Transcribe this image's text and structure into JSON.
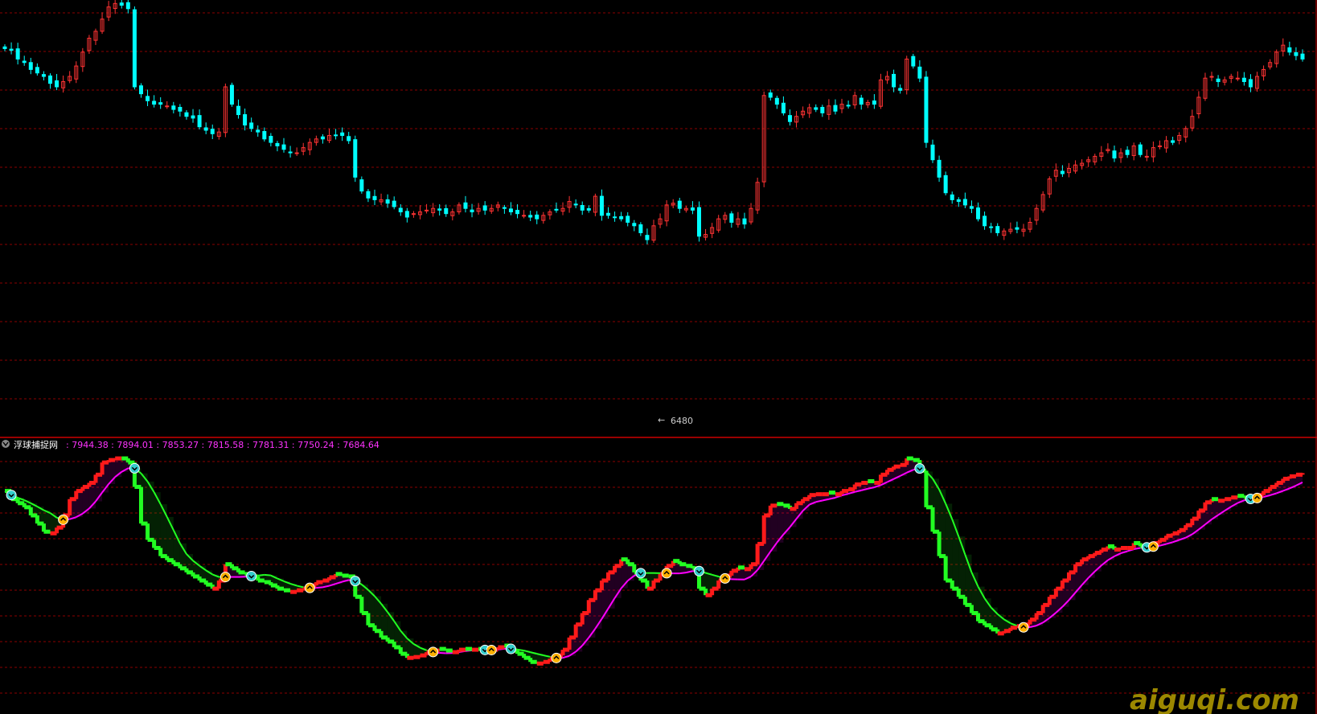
{
  "indicator": {
    "name": "浮球捕捉网",
    "values": [
      "7944.38",
      "7894.01",
      "7853.27",
      "7815.58",
      "7781.31",
      "7750.24",
      "7684.64"
    ],
    "sep": " : "
  },
  "price_pane": {
    "low_marker": "6480"
  },
  "watermark": "aiguqi.com",
  "colors": {
    "background": "#000000",
    "grid": "#8b0000",
    "candle_up": "#ff3333",
    "candle_down": "#00ffff",
    "line_green": "#22ff22",
    "line_red": "#ff1a1a",
    "line_magenta": "#ff00ff",
    "label_cyan": "#00ffff",
    "label_magenta": "#ff33ff",
    "watermark": "#b8a000"
  },
  "chart_data": [
    {
      "type": "candlestick",
      "title": "",
      "xlabel": "",
      "ylabel": "",
      "ylim": [
        6400,
        8900
      ],
      "grid": true,
      "close": [
        8620,
        8610,
        8560,
        8540,
        8500,
        8480,
        8460,
        8420,
        8400,
        8430,
        8460,
        8520,
        8600,
        8680,
        8720,
        8790,
        8860,
        8880,
        8870,
        8850,
        8400,
        8360,
        8320,
        8300,
        8300,
        8290,
        8270,
        8260,
        8230,
        8220,
        8170,
        8150,
        8130,
        8140,
        8400,
        8300,
        8240,
        8180,
        8160,
        8140,
        8100,
        8080,
        8060,
        8040,
        8020,
        8020,
        8050,
        8080,
        8100,
        8100,
        8120,
        8120,
        8120,
        8090,
        7880,
        7800,
        7760,
        7750,
        7750,
        7730,
        7710,
        7680,
        7650,
        7670,
        7680,
        7690,
        7700,
        7690,
        7670,
        7680,
        7720,
        7700,
        7680,
        7700,
        7690,
        7700,
        7720,
        7700,
        7680,
        7670,
        7660,
        7650,
        7640,
        7660,
        7680,
        7690,
        7700,
        7740,
        7720,
        7690,
        7690,
        7770,
        7660,
        7660,
        7650,
        7640,
        7620,
        7600,
        7560,
        7520,
        7600,
        7640,
        7720,
        7730,
        7700,
        7700,
        7690,
        7540,
        7550,
        7590,
        7640,
        7660,
        7620,
        7640,
        7610,
        7700,
        7850,
        8350,
        8340,
        8300,
        8250,
        8200,
        8230,
        8260,
        8280,
        8270,
        8250,
        8290,
        8260,
        8300,
        8290,
        8350,
        8300,
        8310,
        8300,
        8440,
        8460,
        8400,
        8380,
        8560,
        8520,
        8450,
        8080,
        7980,
        7880,
        7790,
        7750,
        7740,
        7720,
        7700,
        7640,
        7600,
        7590,
        7560,
        7570,
        7580,
        7580,
        7580,
        7620,
        7700,
        7780,
        7870,
        7920,
        7900,
        7930,
        7950,
        7960,
        7980,
        8000,
        8020,
        8040,
        7990,
        8020,
        8010,
        8060,
        8010,
        8000,
        8050,
        8060,
        8090,
        8080,
        8120,
        8160,
        8230,
        8340,
        8450,
        8460,
        8430,
        8440,
        8460,
        8450,
        8430,
        8400,
        8460,
        8500,
        8540,
        8600,
        8640,
        8600,
        8580,
        8560
      ]
    },
    {
      "type": "line",
      "title": "浮球捕捉网",
      "xlabel": "",
      "ylabel": "",
      "ylim": [
        7640,
        7960
      ],
      "grid": true,
      "series": [
        {
          "name": "",
          "values": [
            7910,
            7900,
            7895,
            7890,
            7880,
            7870,
            7860,
            7858,
            7865,
            7880,
            7900,
            7910,
            7915,
            7920,
            7930,
            7945,
            7948,
            7950,
            7950,
            7945,
            7915,
            7870,
            7850,
            7840,
            7830,
            7825,
            7820,
            7815,
            7810,
            7805,
            7800,
            7795,
            7790,
            7800,
            7820,
            7815,
            7810,
            7808,
            7805,
            7800,
            7798,
            7794,
            7790,
            7788,
            7786,
            7788,
            7790,
            7794,
            7798,
            7800,
            7804,
            7808,
            7806,
            7805,
            7780,
            7760,
            7745,
            7738,
            7730,
            7725,
            7718,
            7710,
            7705,
            7706,
            7708,
            7712,
            7714,
            7716,
            7714,
            7712,
            7715,
            7716,
            7715,
            7716,
            7714,
            7715,
            7718,
            7720,
            7714,
            7710,
            7705,
            7700,
            7698,
            7700,
            7704,
            7708,
            7715,
            7730,
            7746,
            7760,
            7776,
            7788,
            7800,
            7810,
            7818,
            7826,
            7820,
            7810,
            7800,
            7790,
            7800,
            7808,
            7818,
            7824,
            7820,
            7818,
            7815,
            7790,
            7782,
            7790,
            7800,
            7806,
            7812,
            7816,
            7814,
            7820,
            7845,
            7880,
            7892,
            7894,
            7892,
            7888,
            7895,
            7900,
            7905,
            7906,
            7906,
            7908,
            7906,
            7910,
            7912,
            7918,
            7920,
            7922,
            7920,
            7930,
            7936,
            7940,
            7942,
            7950,
            7948,
            7935,
            7890,
            7860,
            7830,
            7800,
            7790,
            7780,
            7770,
            7760,
            7750,
            7745,
            7740,
            7735,
            7738,
            7742,
            7744,
            7746,
            7752,
            7760,
            7770,
            7780,
            7790,
            7800,
            7810,
            7820,
            7826,
            7830,
            7834,
            7838,
            7842,
            7838,
            7840,
            7840,
            7846,
            7842,
            7840,
            7846,
            7850,
            7855,
            7858,
            7862,
            7868,
            7876,
            7886,
            7896,
            7900,
            7898,
            7900,
            7902,
            7904,
            7902,
            7900,
            7905,
            7910,
            7915,
            7920,
            7925,
            7928,
            7930,
            7932
          ]
        }
      ]
    }
  ]
}
